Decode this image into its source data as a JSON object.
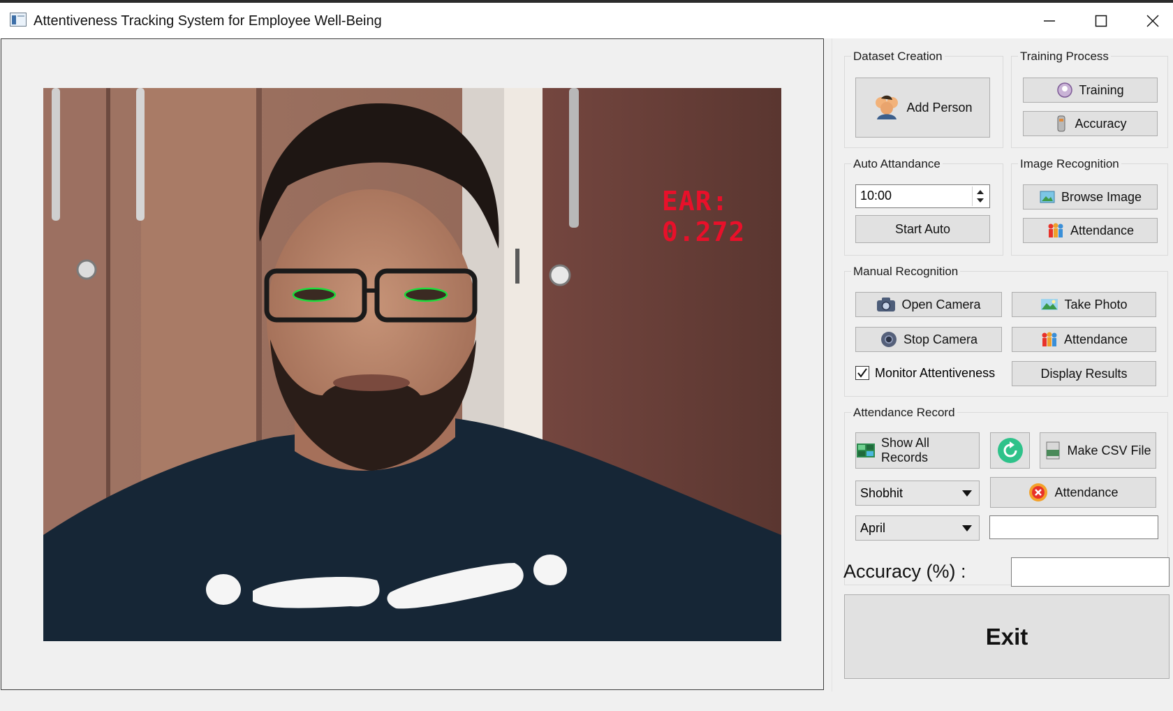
{
  "window": {
    "title": "Attentiveness Tracking System for Employee Well-Being"
  },
  "video": {
    "ear_text": "EAR: 0.272"
  },
  "dataset_creation": {
    "title": "Dataset Creation",
    "add_person": "Add Person"
  },
  "training_process": {
    "title": "Training Process",
    "training": "Training",
    "accuracy": "Accuracy"
  },
  "auto_attendance": {
    "title": "Auto Attandance",
    "time_value": "10:00",
    "start_auto": "Start Auto"
  },
  "image_recognition": {
    "title": "Image Recognition",
    "browse_image": "Browse Image",
    "attendance": "Attendance"
  },
  "manual_recognition": {
    "title": "Manual Recognition",
    "open_camera": "Open Camera",
    "take_photo": "Take Photo",
    "stop_camera": "Stop Camera",
    "attendance": "Attendance",
    "monitor_label": "Monitor Attentiveness",
    "monitor_checked": true,
    "display_results": "Display Results"
  },
  "attendance_record": {
    "title": "Attendance Record",
    "show_all": "Show All Records",
    "make_csv": "Make CSV File",
    "person_select": "Shobhit",
    "attendance": "Attendance",
    "month_select": "April",
    "result_value": ""
  },
  "accuracy": {
    "label": "Accuracy (%) :",
    "value": ""
  },
  "exit_label": "Exit",
  "colors": {
    "ear_text": "#e8102a",
    "eye_contour": "#1edc3c",
    "refresh_icon": "#2ec28a",
    "attendance_icon": "#e8322a"
  }
}
